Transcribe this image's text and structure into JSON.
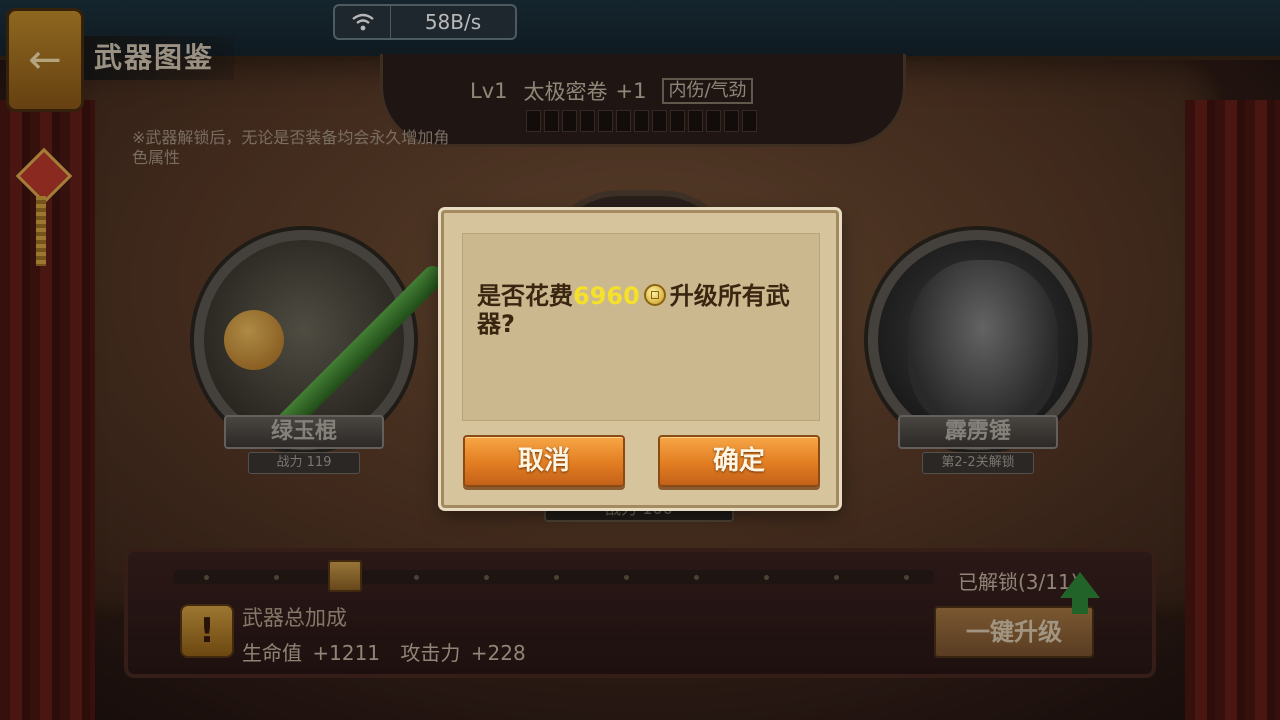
{
  "status_bar": {
    "net_speed": "58B/s",
    "wifi_icon": "wifi-icon"
  },
  "header": {
    "title": "武器图鉴",
    "back_icon": "back-arrow-icon"
  },
  "level": {
    "lv": "Lv1",
    "item": "太极密卷",
    "plus": "+1",
    "type_tag": "内伤/气劲",
    "pips_total": 13,
    "pips_filled": 0
  },
  "note": "※武器解锁后，无论是否装备均会永久增加角色属性",
  "weapons": {
    "left": {
      "name": "绿玉棍",
      "sub": "战力 119"
    },
    "right": {
      "name": "霹雳锤",
      "sub": "第2-2关解锁"
    },
    "center": {
      "sub": "战力 100"
    }
  },
  "progress": {
    "unlocked_label": "已解锁(3/11)",
    "unlocked": 3,
    "total": 11,
    "current_index": 2
  },
  "bonus": {
    "title": "武器总加成",
    "hp_label": "生命值",
    "hp_value": "+1211",
    "atk_label": "攻击力",
    "atk_value": "+228",
    "upgrade_label": "一键升级"
  },
  "dialog": {
    "msg_prefix": "是否花费",
    "cost": "6960",
    "msg_suffix": "升级所有武器?",
    "cancel_label": "取消",
    "confirm_label": "确定",
    "coin_icon": "coin-icon"
  },
  "colors": {
    "cost_highlight": "#f5e02a",
    "button_orange": "#e27d22",
    "dialog_bg": "#d6c49c"
  }
}
